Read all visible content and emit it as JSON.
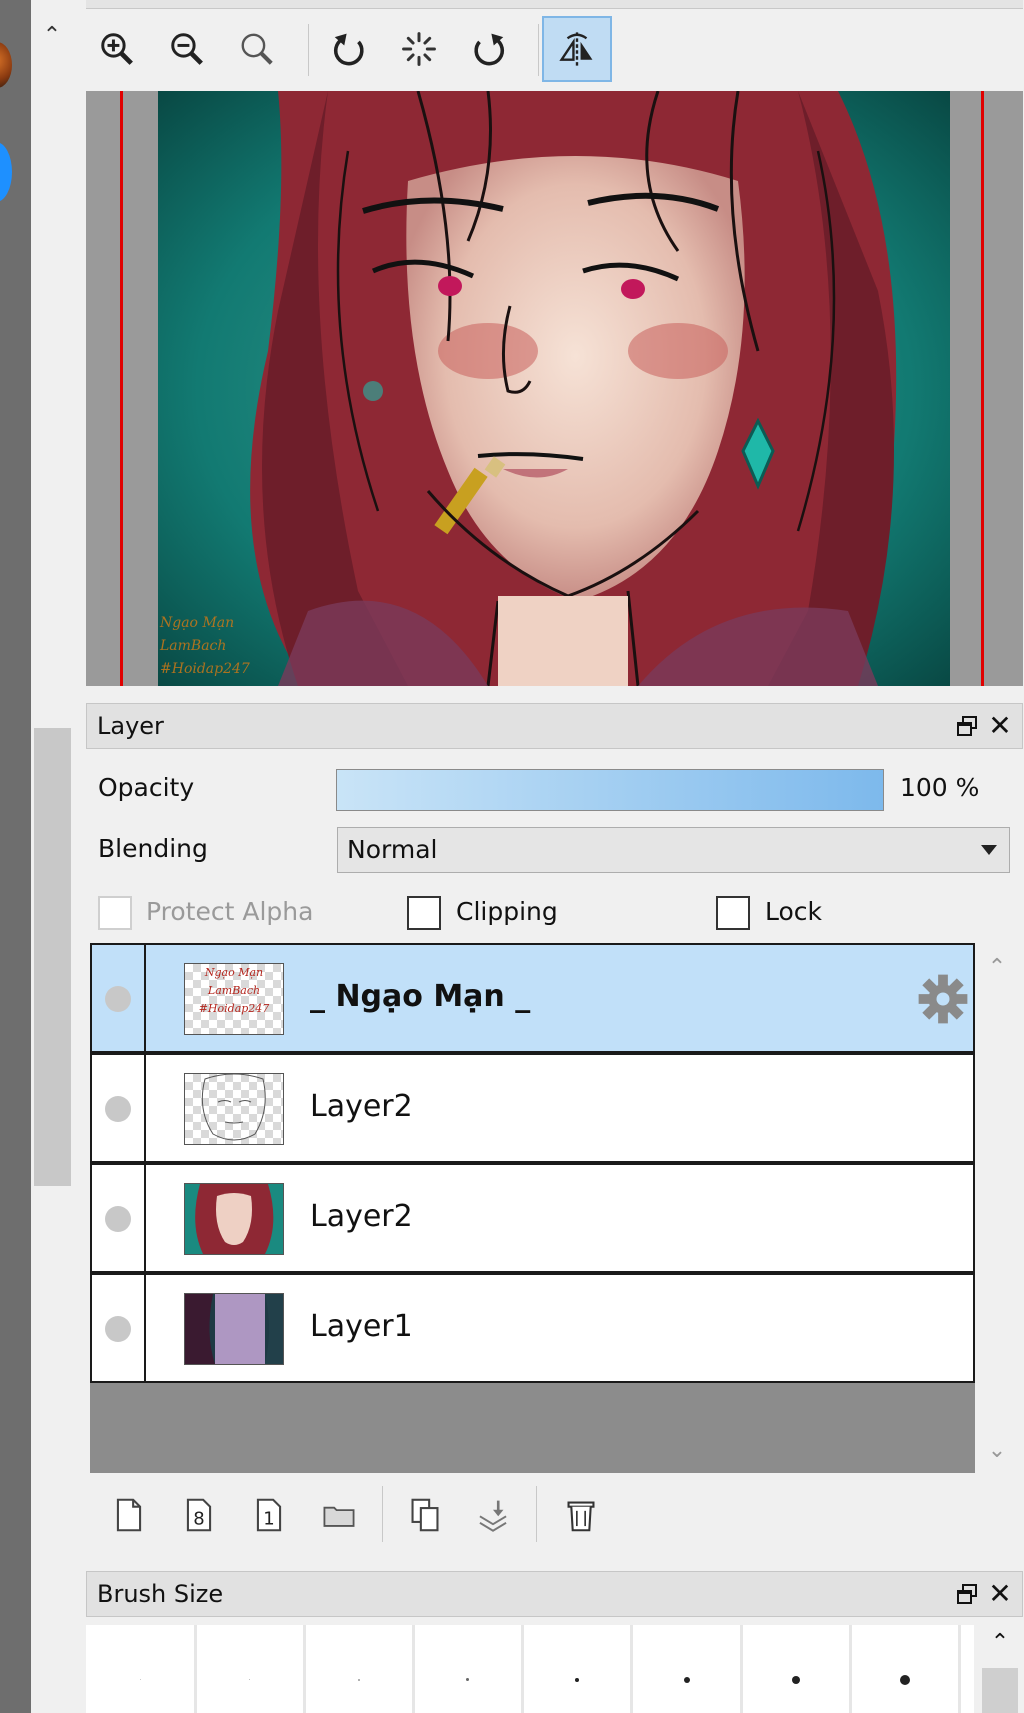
{
  "toolbar": {
    "buttons": [
      {
        "name": "zoom-in-icon"
      },
      {
        "name": "zoom-out-icon"
      },
      {
        "name": "zoom-reset-icon"
      },
      {
        "name": "rotate-left-icon"
      },
      {
        "name": "rotate-reset-icon"
      },
      {
        "name": "rotate-right-icon"
      },
      {
        "name": "flip-horizontal-icon",
        "active": true
      }
    ]
  },
  "canvas": {
    "watermark_lines": [
      "Ngạo Mạn",
      "LamBach",
      "#Hoidap247"
    ]
  },
  "layer_panel": {
    "title": "Layer",
    "opacity_label": "Opacity",
    "opacity_value": "100 %",
    "opacity_fraction": 1.0,
    "blending_label": "Blending",
    "blending_value": "Normal",
    "protect_alpha_label": "Protect Alpha",
    "clipping_label": "Clipping",
    "lock_label": "Lock",
    "layers": [
      {
        "name": "_ Ngạo Mạn _",
        "selected": true
      },
      {
        "name": "Layer2",
        "selected": false
      },
      {
        "name": "Layer2",
        "selected": false
      },
      {
        "name": "Layer1",
        "selected": false
      }
    ],
    "thumb_watermark_lines": [
      "Ngạo Mạn",
      "LamBach",
      "#Hoidap247"
    ]
  },
  "brush_panel": {
    "title": "Brush Size"
  },
  "colors": {
    "selection": "#c1e0f9",
    "accent": "#7db9ec",
    "guide_red": "#e00000"
  }
}
